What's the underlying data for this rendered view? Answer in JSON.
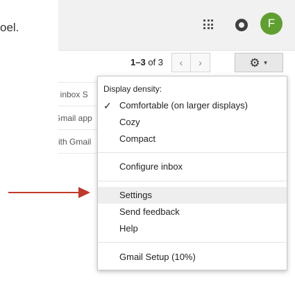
{
  "background_label": {
    "text": "oel."
  },
  "header": {
    "apps_icon": "apps-grid-icon",
    "notifications_icon": "notifications-icon",
    "avatar_initial": "F",
    "avatar_color": "#5f9f2f"
  },
  "toolbar": {
    "page_range": "1–3",
    "page_of": "of 3",
    "prev_label": "‹",
    "next_label": "›",
    "settings_icon": "gear-icon",
    "settings_caret": "▼"
  },
  "mail_rows": [
    {
      "snippet": "il inbox S"
    },
    {
      "snippet": "Gmail app"
    },
    {
      "snippet": "vith Gmail"
    }
  ],
  "settings_menu": {
    "heading": "Display density:",
    "density_options": [
      {
        "label": "Comfortable (on larger displays)",
        "checked": true
      },
      {
        "label": "Cozy",
        "checked": false
      },
      {
        "label": "Compact",
        "checked": false
      }
    ],
    "configure_inbox": "Configure inbox",
    "settings": "Settings",
    "send_feedback": "Send feedback",
    "help": "Help",
    "gmail_setup": "Gmail Setup (10%)",
    "check_mark": "✓",
    "highlight_color": "#eeeeee"
  },
  "annotation": {
    "arrow_color": "#c0392b",
    "target": "Settings"
  }
}
